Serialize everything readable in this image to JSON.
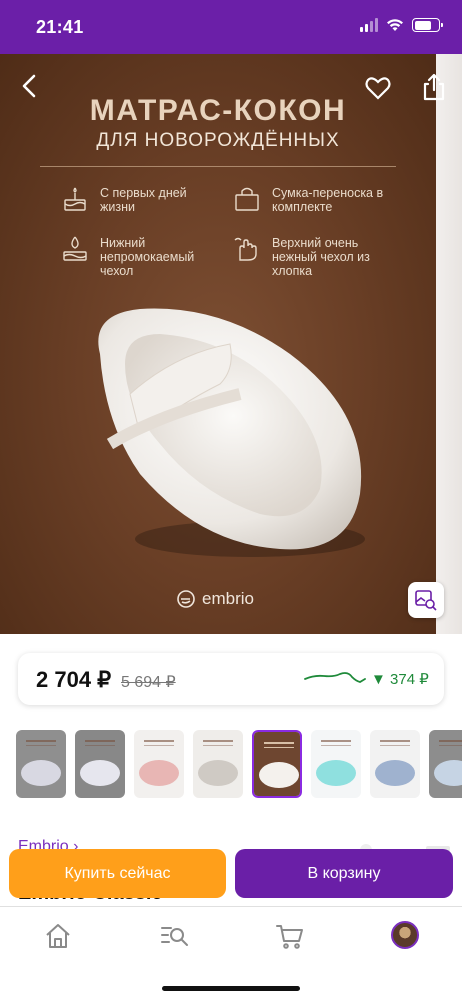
{
  "status_bar": {
    "time": "21:41"
  },
  "hero": {
    "title_line1": "МАТРАС-КОКОН",
    "title_line2": "ДЛЯ НОВОРОЖДЁННЫХ",
    "features": [
      {
        "icon": "cake-icon",
        "text": "С первых дней жизни"
      },
      {
        "icon": "bag-icon",
        "text": "Сумка-переноска в комплекте"
      },
      {
        "icon": "water-drop-icon",
        "text": "Нижний непромокаемый чехол"
      },
      {
        "icon": "hand-icon",
        "text": "Верхний очень нежный чехол из хлопка"
      }
    ],
    "brand": "embrio"
  },
  "price": {
    "current": "2 704 ₽",
    "old": "5 694 ₽",
    "diff": "▼ 374 ₽"
  },
  "seller": {
    "link": "Embrio ›"
  },
  "product_title_peek": "Embrio Classic",
  "actions": {
    "buy_now": "Купить сейчас",
    "add_to_cart": "В корзину"
  },
  "colors": {
    "accent": "#6a1fa7",
    "buy": "#ff9f1a",
    "price_drop": "#1f8a3a"
  },
  "thumbnails": [
    {
      "name": "thumb-1",
      "selected": false
    },
    {
      "name": "thumb-2",
      "selected": false
    },
    {
      "name": "thumb-3",
      "selected": false
    },
    {
      "name": "thumb-4",
      "selected": false
    },
    {
      "name": "thumb-5",
      "selected": true
    },
    {
      "name": "thumb-6",
      "selected": false
    },
    {
      "name": "thumb-7",
      "selected": false
    },
    {
      "name": "thumb-8",
      "selected": false
    }
  ],
  "tabbar": [
    "home-icon",
    "catalog-search-icon",
    "cart-icon",
    "profile-avatar"
  ]
}
